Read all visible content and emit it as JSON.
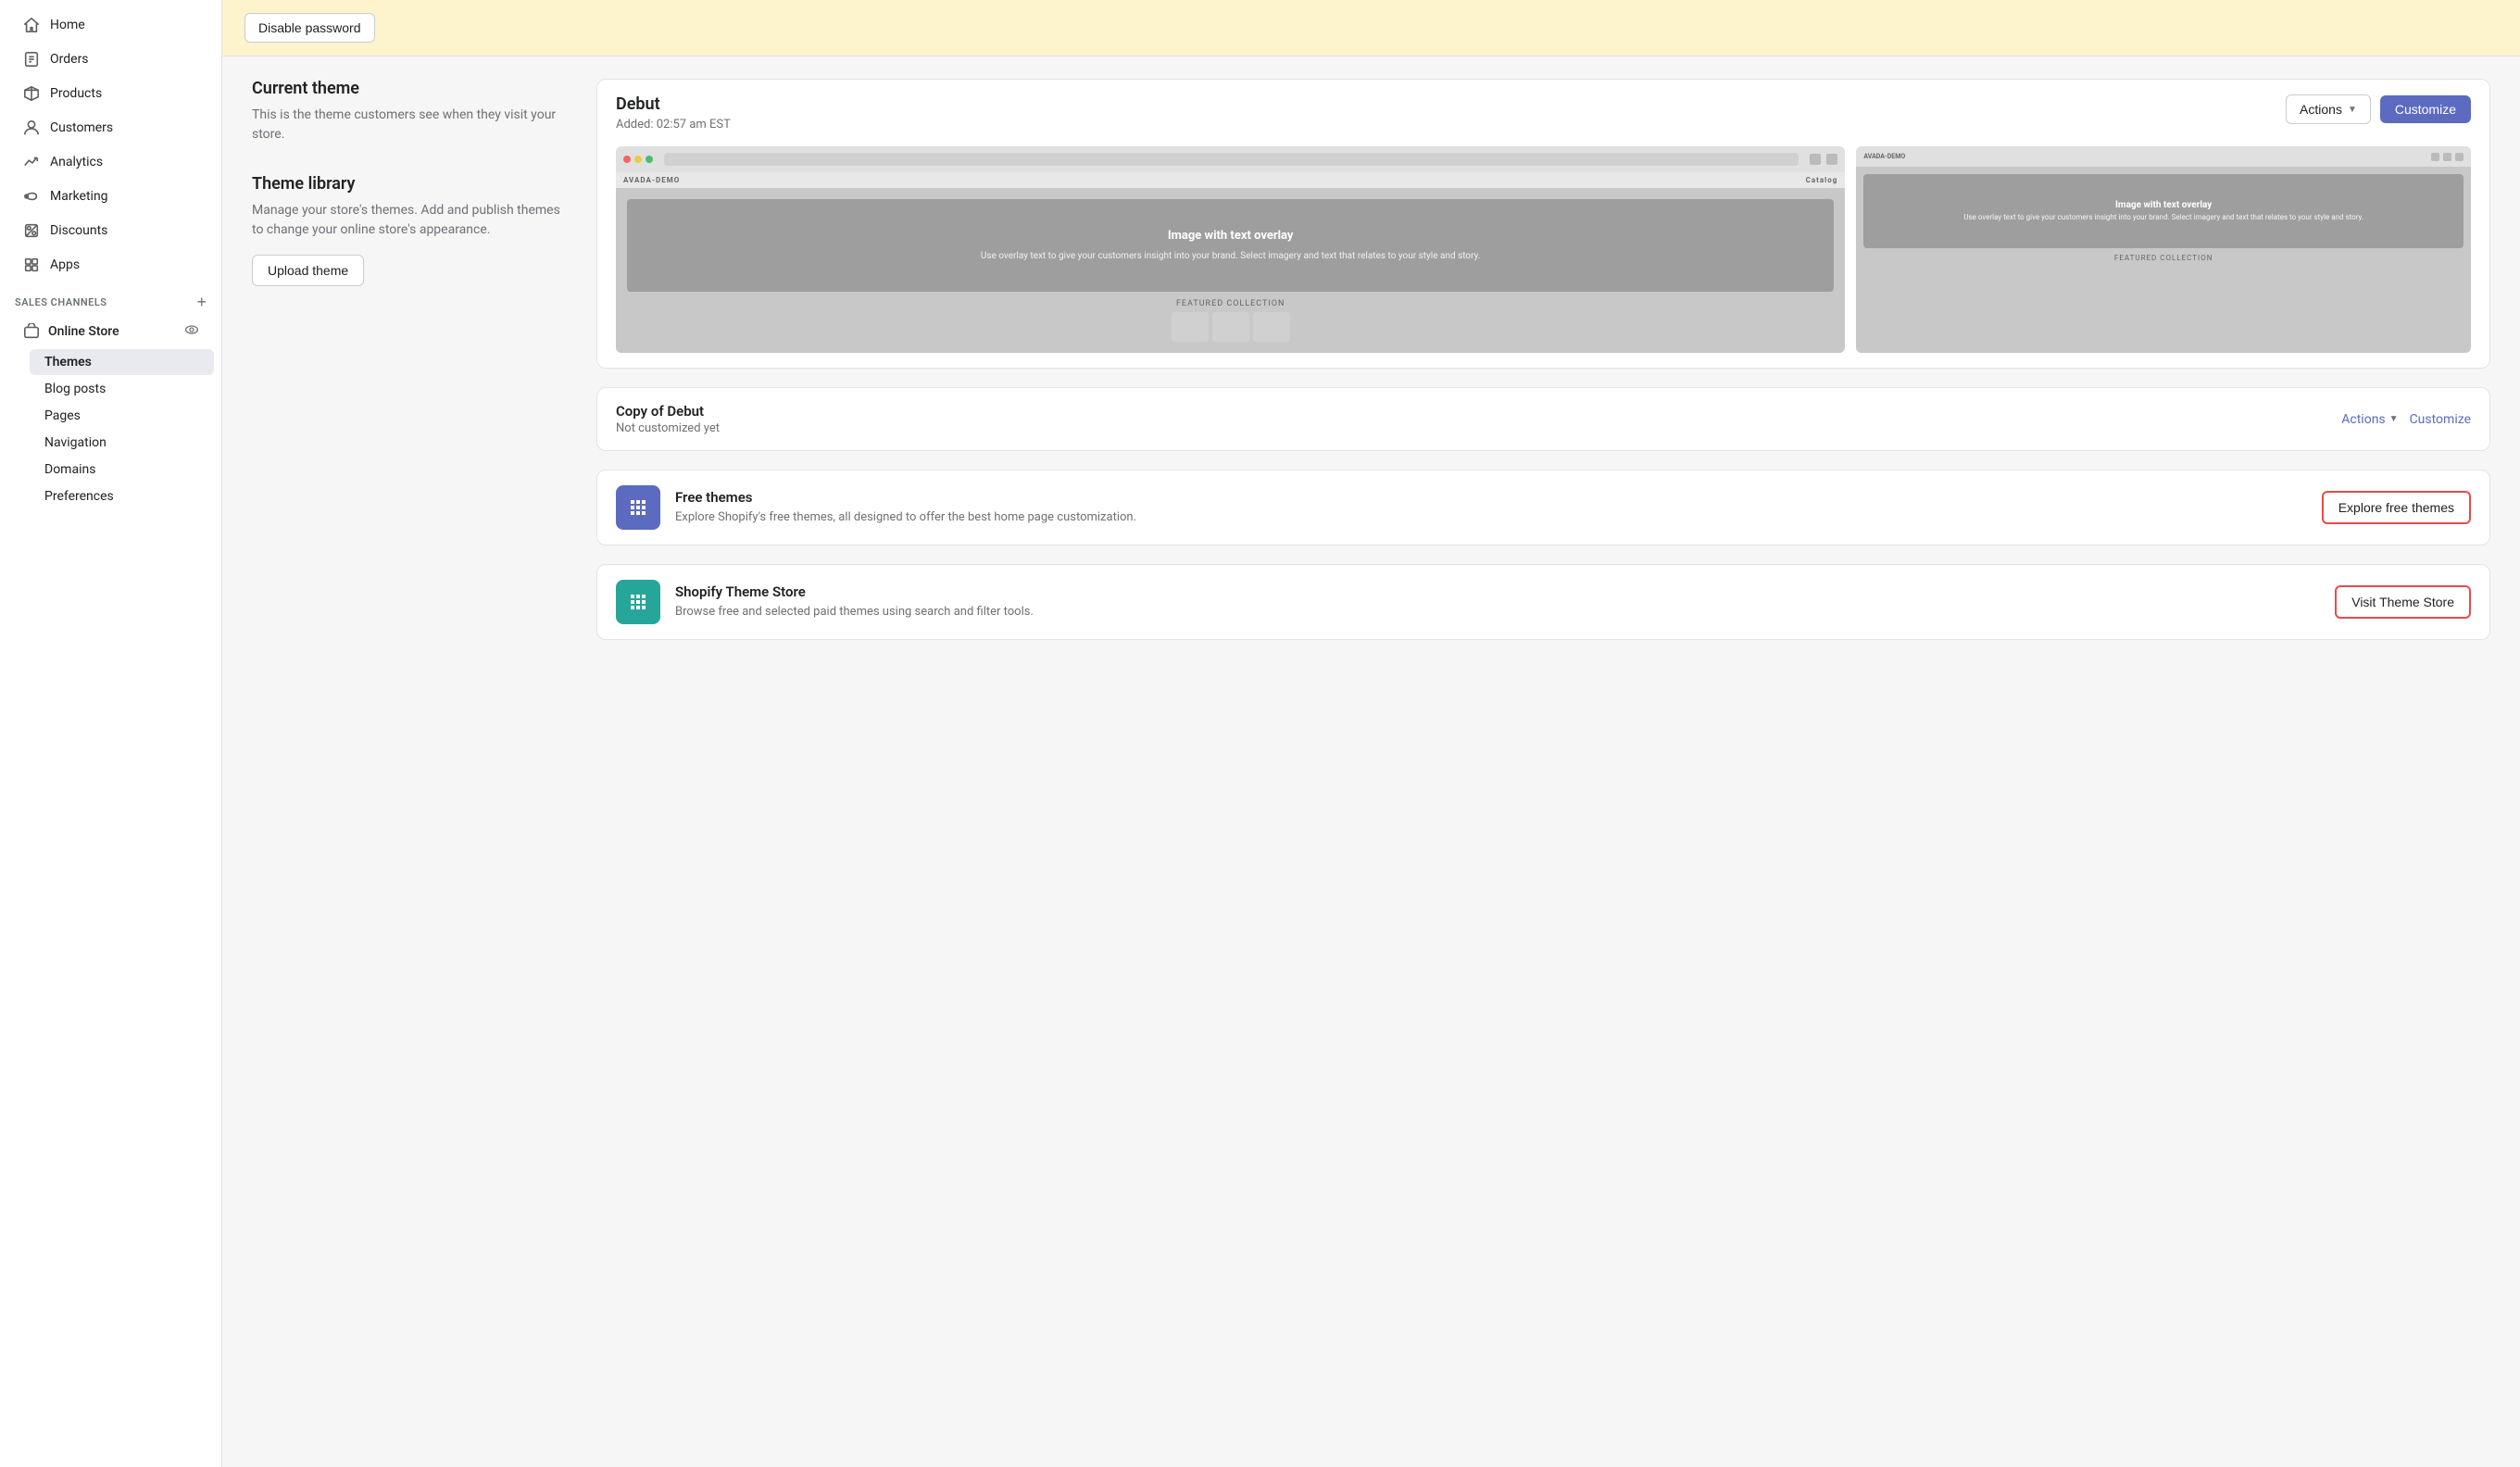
{
  "sidebar": {
    "nav_items": [
      {
        "id": "home",
        "label": "Home",
        "icon": "home"
      },
      {
        "id": "orders",
        "label": "Orders",
        "icon": "orders"
      },
      {
        "id": "products",
        "label": "Products",
        "icon": "products"
      },
      {
        "id": "customers",
        "label": "Customers",
        "icon": "customers"
      },
      {
        "id": "analytics",
        "label": "Analytics",
        "icon": "analytics"
      },
      {
        "id": "marketing",
        "label": "Marketing",
        "icon": "marketing"
      },
      {
        "id": "discounts",
        "label": "Discounts",
        "icon": "discounts"
      },
      {
        "id": "apps",
        "label": "Apps",
        "icon": "apps"
      }
    ],
    "sales_channels_label": "SALES CHANNELS",
    "online_store_label": "Online Store",
    "sub_items": [
      {
        "id": "themes",
        "label": "Themes",
        "active": true
      },
      {
        "id": "blog-posts",
        "label": "Blog posts"
      },
      {
        "id": "pages",
        "label": "Pages"
      },
      {
        "id": "navigation",
        "label": "Navigation"
      },
      {
        "id": "domains",
        "label": "Domains"
      },
      {
        "id": "preferences",
        "label": "Preferences"
      }
    ]
  },
  "banner": {
    "disable_password_btn": "Disable password"
  },
  "current_theme": {
    "section_title": "Current theme",
    "section_desc": "This is the theme customers see when they visit your store.",
    "theme_name": "Debut",
    "theme_meta": "Added: 02:57 am EST",
    "actions_btn": "Actions",
    "customize_btn": "Customize",
    "preview_brand": "AVADA-DEMO",
    "preview_hero_title": "Image with text overlay",
    "preview_hero_text": "Use overlay text to give your customers insight into your brand. Select imagery and text that relates to your style and story.",
    "preview_featured": "FEATURED COLLECTION",
    "preview_mobile_hero_title": "Image with text overlay",
    "preview_mobile_hero_text": "Use overlay text to give your customers insight into your brand. Select imagery and text that relates to your style and story."
  },
  "theme_library": {
    "section_title": "Theme library",
    "section_desc": "Manage your store's themes. Add and publish themes to change your online store's appearance.",
    "upload_btn": "Upload theme"
  },
  "copy_theme": {
    "name": "Copy of Debut",
    "meta": "Not customized yet",
    "actions_label": "Actions",
    "customize_label": "Customize"
  },
  "free_themes": {
    "title": "Free themes",
    "desc": "Explore Shopify's free themes, all designed to offer the best home page customization.",
    "btn_label": "Explore free themes"
  },
  "theme_store": {
    "title": "Shopify Theme Store",
    "desc": "Browse free and selected paid themes using search and filter tools.",
    "btn_label": "Visit Theme Store"
  }
}
